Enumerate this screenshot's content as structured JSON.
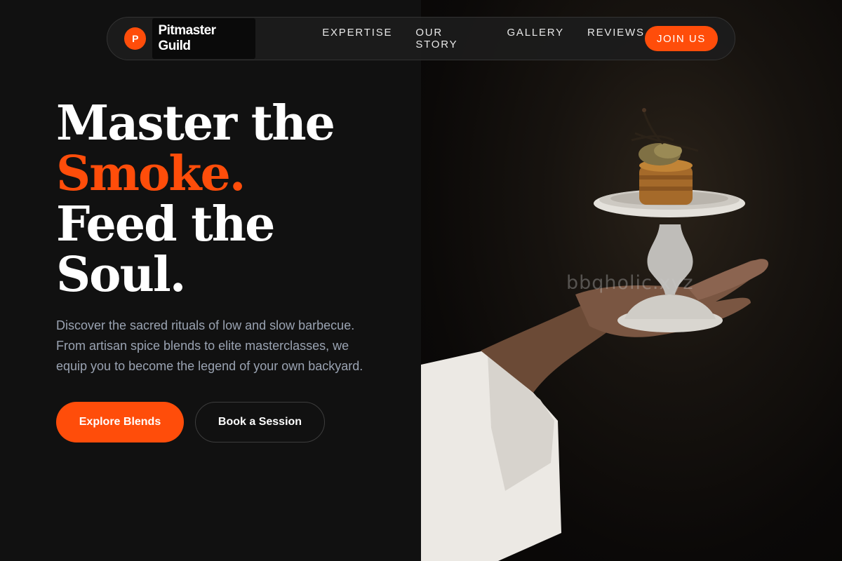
{
  "nav": {
    "logo_letter": "P",
    "brand": "Pitmaster Guild",
    "links": [
      "EXPERTISE",
      "OUR STORY",
      "GALLERY",
      "REVIEWS"
    ],
    "cta": "JOIN US"
  },
  "hero": {
    "line1": "Master the",
    "line2": "Smoke.",
    "line3": "Feed the",
    "line4": "Soul.",
    "description": "Discover the sacred rituals of low and slow barbecue. From artisan spice blends to elite masterclasses, we equip you to become the legend of your own backyard.",
    "primary_button": "Explore Blends",
    "secondary_button": "Book a Session"
  },
  "photo": {
    "watermark": "bbqholic.xyz"
  },
  "colors": {
    "accent": "#ff4d0a",
    "background": "#111111",
    "muted_text": "#9aa3b2"
  }
}
